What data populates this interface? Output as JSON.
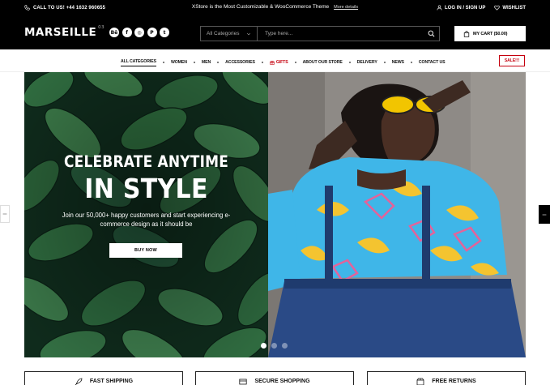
{
  "topbar": {
    "phone": "CALL TO US! +44 1632 960655",
    "promo": "XStore is the Most Customizable & WooCommerce Theme",
    "promo_link": "More details",
    "login": "LOG IN / SIGN UP",
    "wishlist": "WISHLIST",
    "icons": [
      "phone-icon",
      "user-icon",
      "heart-icon"
    ]
  },
  "header": {
    "logo": "MARSEILLE",
    "logo_sup": "03",
    "socials": [
      {
        "name": "behance-icon",
        "glyph": "Bē"
      },
      {
        "name": "facebook-icon",
        "glyph": "f"
      },
      {
        "name": "instagram-icon",
        "glyph": "◎"
      },
      {
        "name": "pinterest-icon",
        "glyph": "P"
      },
      {
        "name": "twitter-icon",
        "glyph": "t"
      }
    ],
    "search": {
      "category": "All Categories",
      "placeholder": "Type here..."
    },
    "cart": "MY CART ($0.00)"
  },
  "nav": {
    "items": [
      "ALL CATEGORIES",
      "WOMEN",
      "MEN",
      "ACCESSORIES",
      "GIFTS",
      "ABOUT OUR STORE",
      "DELIVERY",
      "NEWS",
      "CONTACT US"
    ],
    "sale": "SALE!!!",
    "accent": "#c5000e"
  },
  "hero": {
    "subtitle": "CELEBRATE ANYTIME",
    "title": "IN STYLE",
    "description": "Join our 50,000+ happy customers and start experiencing e-commerce design as it should be",
    "button": "BUY NOW",
    "slide_count": 3,
    "active_slide": 1
  },
  "features": [
    {
      "label": "FAST SHIPPING",
      "icon": "rocket-icon"
    },
    {
      "label": "SECURE SHOPPING",
      "icon": "credit-card-icon"
    },
    {
      "label": "FREE RETURNS",
      "icon": "box-icon"
    }
  ]
}
